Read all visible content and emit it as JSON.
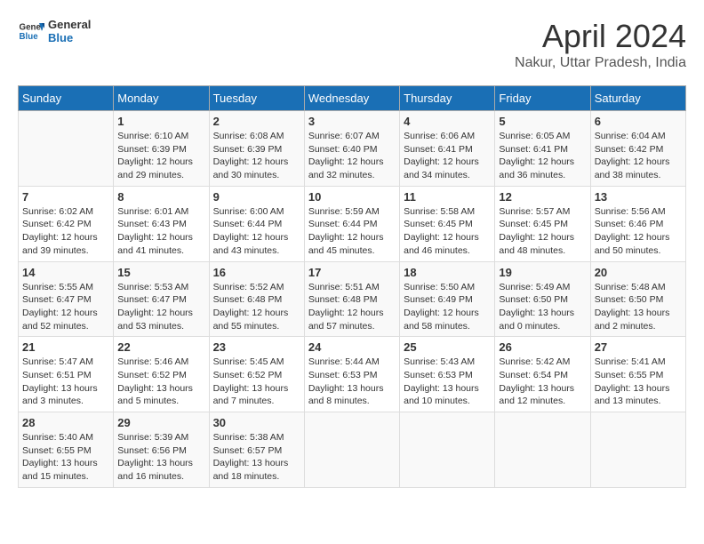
{
  "header": {
    "logo_line1": "General",
    "logo_line2": "Blue",
    "title": "April 2024",
    "subtitle": "Nakur, Uttar Pradesh, India"
  },
  "weekdays": [
    "Sunday",
    "Monday",
    "Tuesday",
    "Wednesday",
    "Thursday",
    "Friday",
    "Saturday"
  ],
  "weeks": [
    [
      {
        "day": "",
        "info": ""
      },
      {
        "day": "1",
        "info": "Sunrise: 6:10 AM\nSunset: 6:39 PM\nDaylight: 12 hours\nand 29 minutes."
      },
      {
        "day": "2",
        "info": "Sunrise: 6:08 AM\nSunset: 6:39 PM\nDaylight: 12 hours\nand 30 minutes."
      },
      {
        "day": "3",
        "info": "Sunrise: 6:07 AM\nSunset: 6:40 PM\nDaylight: 12 hours\nand 32 minutes."
      },
      {
        "day": "4",
        "info": "Sunrise: 6:06 AM\nSunset: 6:41 PM\nDaylight: 12 hours\nand 34 minutes."
      },
      {
        "day": "5",
        "info": "Sunrise: 6:05 AM\nSunset: 6:41 PM\nDaylight: 12 hours\nand 36 minutes."
      },
      {
        "day": "6",
        "info": "Sunrise: 6:04 AM\nSunset: 6:42 PM\nDaylight: 12 hours\nand 38 minutes."
      }
    ],
    [
      {
        "day": "7",
        "info": "Sunrise: 6:02 AM\nSunset: 6:42 PM\nDaylight: 12 hours\nand 39 minutes."
      },
      {
        "day": "8",
        "info": "Sunrise: 6:01 AM\nSunset: 6:43 PM\nDaylight: 12 hours\nand 41 minutes."
      },
      {
        "day": "9",
        "info": "Sunrise: 6:00 AM\nSunset: 6:44 PM\nDaylight: 12 hours\nand 43 minutes."
      },
      {
        "day": "10",
        "info": "Sunrise: 5:59 AM\nSunset: 6:44 PM\nDaylight: 12 hours\nand 45 minutes."
      },
      {
        "day": "11",
        "info": "Sunrise: 5:58 AM\nSunset: 6:45 PM\nDaylight: 12 hours\nand 46 minutes."
      },
      {
        "day": "12",
        "info": "Sunrise: 5:57 AM\nSunset: 6:45 PM\nDaylight: 12 hours\nand 48 minutes."
      },
      {
        "day": "13",
        "info": "Sunrise: 5:56 AM\nSunset: 6:46 PM\nDaylight: 12 hours\nand 50 minutes."
      }
    ],
    [
      {
        "day": "14",
        "info": "Sunrise: 5:55 AM\nSunset: 6:47 PM\nDaylight: 12 hours\nand 52 minutes."
      },
      {
        "day": "15",
        "info": "Sunrise: 5:53 AM\nSunset: 6:47 PM\nDaylight: 12 hours\nand 53 minutes."
      },
      {
        "day": "16",
        "info": "Sunrise: 5:52 AM\nSunset: 6:48 PM\nDaylight: 12 hours\nand 55 minutes."
      },
      {
        "day": "17",
        "info": "Sunrise: 5:51 AM\nSunset: 6:48 PM\nDaylight: 12 hours\nand 57 minutes."
      },
      {
        "day": "18",
        "info": "Sunrise: 5:50 AM\nSunset: 6:49 PM\nDaylight: 12 hours\nand 58 minutes."
      },
      {
        "day": "19",
        "info": "Sunrise: 5:49 AM\nSunset: 6:50 PM\nDaylight: 13 hours\nand 0 minutes."
      },
      {
        "day": "20",
        "info": "Sunrise: 5:48 AM\nSunset: 6:50 PM\nDaylight: 13 hours\nand 2 minutes."
      }
    ],
    [
      {
        "day": "21",
        "info": "Sunrise: 5:47 AM\nSunset: 6:51 PM\nDaylight: 13 hours\nand 3 minutes."
      },
      {
        "day": "22",
        "info": "Sunrise: 5:46 AM\nSunset: 6:52 PM\nDaylight: 13 hours\nand 5 minutes."
      },
      {
        "day": "23",
        "info": "Sunrise: 5:45 AM\nSunset: 6:52 PM\nDaylight: 13 hours\nand 7 minutes."
      },
      {
        "day": "24",
        "info": "Sunrise: 5:44 AM\nSunset: 6:53 PM\nDaylight: 13 hours\nand 8 minutes."
      },
      {
        "day": "25",
        "info": "Sunrise: 5:43 AM\nSunset: 6:53 PM\nDaylight: 13 hours\nand 10 minutes."
      },
      {
        "day": "26",
        "info": "Sunrise: 5:42 AM\nSunset: 6:54 PM\nDaylight: 13 hours\nand 12 minutes."
      },
      {
        "day": "27",
        "info": "Sunrise: 5:41 AM\nSunset: 6:55 PM\nDaylight: 13 hours\nand 13 minutes."
      }
    ],
    [
      {
        "day": "28",
        "info": "Sunrise: 5:40 AM\nSunset: 6:55 PM\nDaylight: 13 hours\nand 15 minutes."
      },
      {
        "day": "29",
        "info": "Sunrise: 5:39 AM\nSunset: 6:56 PM\nDaylight: 13 hours\nand 16 minutes."
      },
      {
        "day": "30",
        "info": "Sunrise: 5:38 AM\nSunset: 6:57 PM\nDaylight: 13 hours\nand 18 minutes."
      },
      {
        "day": "",
        "info": ""
      },
      {
        "day": "",
        "info": ""
      },
      {
        "day": "",
        "info": ""
      },
      {
        "day": "",
        "info": ""
      }
    ]
  ]
}
